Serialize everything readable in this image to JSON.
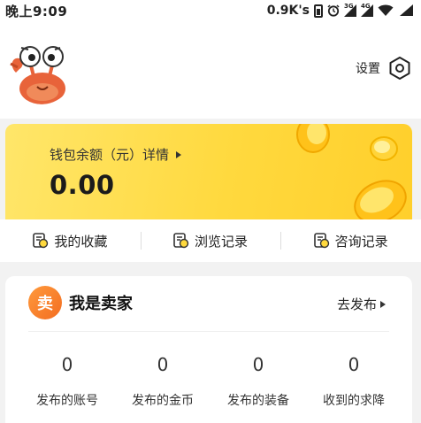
{
  "status_bar": {
    "time": "晚上9:09",
    "speed": "0.9K's",
    "signal1_label": "3G",
    "signal2_label": "4G"
  },
  "header": {
    "settings_label": "设置"
  },
  "wallet": {
    "label": "钱包余额（元）详情",
    "amount": "0.00"
  },
  "quick_links": [
    {
      "label": "我的收藏",
      "icon": "favorites-icon"
    },
    {
      "label": "浏览记录",
      "icon": "history-icon"
    },
    {
      "label": "咨询记录",
      "icon": "consult-icon"
    }
  ],
  "seller": {
    "badge": "卖",
    "title": "我是卖家",
    "publish_label": "去发布",
    "stats": [
      {
        "value": "0",
        "label": "发布的账号"
      },
      {
        "value": "0",
        "label": "发布的金币"
      },
      {
        "value": "0",
        "label": "发布的装备"
      },
      {
        "value": "0",
        "label": "收到的求降"
      }
    ]
  },
  "colors": {
    "wallet_yellow": "#ffd93e",
    "seller_badge": "#f36d21",
    "background": "#f2f2f2"
  }
}
